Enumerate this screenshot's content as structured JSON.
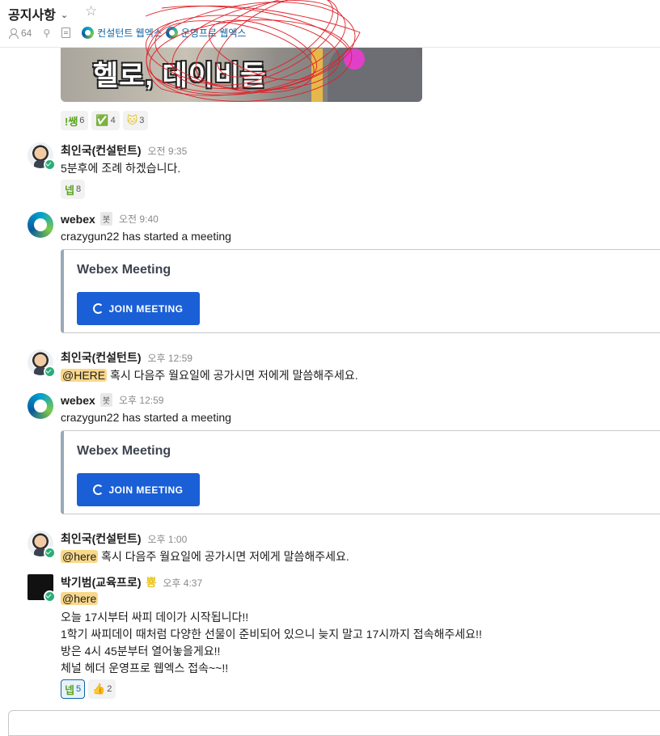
{
  "header": {
    "channel_name": "공지사항",
    "member_count": "64",
    "bookmarks": [
      {
        "label": "컨설턴트 웹엑스"
      },
      {
        "label": "운영프로 웹엑스"
      }
    ]
  },
  "image_preview": {
    "caption_text": "헬로, 데이비들"
  },
  "reactions_top": [
    {
      "emoji": "!쌩",
      "count": "6",
      "color": "#5aa51e"
    },
    {
      "emoji": "✅",
      "count": "4",
      "color": "#2bac76"
    },
    {
      "emoji": "🐱",
      "count": "3",
      "color": "#e8c21a"
    }
  ],
  "messages": [
    {
      "sender": "최인국(컨설턴트)",
      "time": "오전 9:35",
      "text": "5분후에 조례 하겠습니다.",
      "reactions": [
        {
          "emoji": "넵",
          "count": "8"
        }
      ]
    },
    {
      "sender": "webex",
      "badge": "봇",
      "time": "오전 9:40",
      "text": "crazygun22 has started a meeting",
      "card": {
        "title": "Webex Meeting",
        "button": "JOIN MEETING"
      }
    },
    {
      "sender": "최인국(컨설턴트)",
      "time": "오후 12:59",
      "mention": "@HERE",
      "text": " 혹시 다음주 월요일에 공가시면 저에게 말씀해주세요."
    },
    {
      "sender": "webex",
      "badge": "봇",
      "time": "오후 12:59",
      "text": "crazygun22 has started a meeting",
      "card": {
        "title": "Webex Meeting",
        "button": "JOIN MEETING"
      }
    },
    {
      "sender": "최인국(컨설턴트)",
      "time": "오후 1:00",
      "mention": "@here",
      "text": " 혹시 다음주 월요일에 공가시면 저에게 말씀해주세요."
    },
    {
      "sender": "박기범(교육프로)",
      "badge_emoji": "뿅",
      "time": "오후 4:37",
      "mention": "@here",
      "lines": [
        "오늘 17시부터 싸피 데이가 시작됩니다!!",
        "1학기 싸피데이 때처럼 다양한 선물이 준비되어 있으니 늦지 말고 17시까지 접속해주세요!!",
        "방은 4시 45분부터 열어놓을게요!!",
        "체널 헤더 운영프로 웹엑스 접속~~!!"
      ],
      "reactions": [
        {
          "emoji": "넵",
          "count": "5"
        },
        {
          "emoji": "👍",
          "count": "2"
        }
      ]
    }
  ]
}
